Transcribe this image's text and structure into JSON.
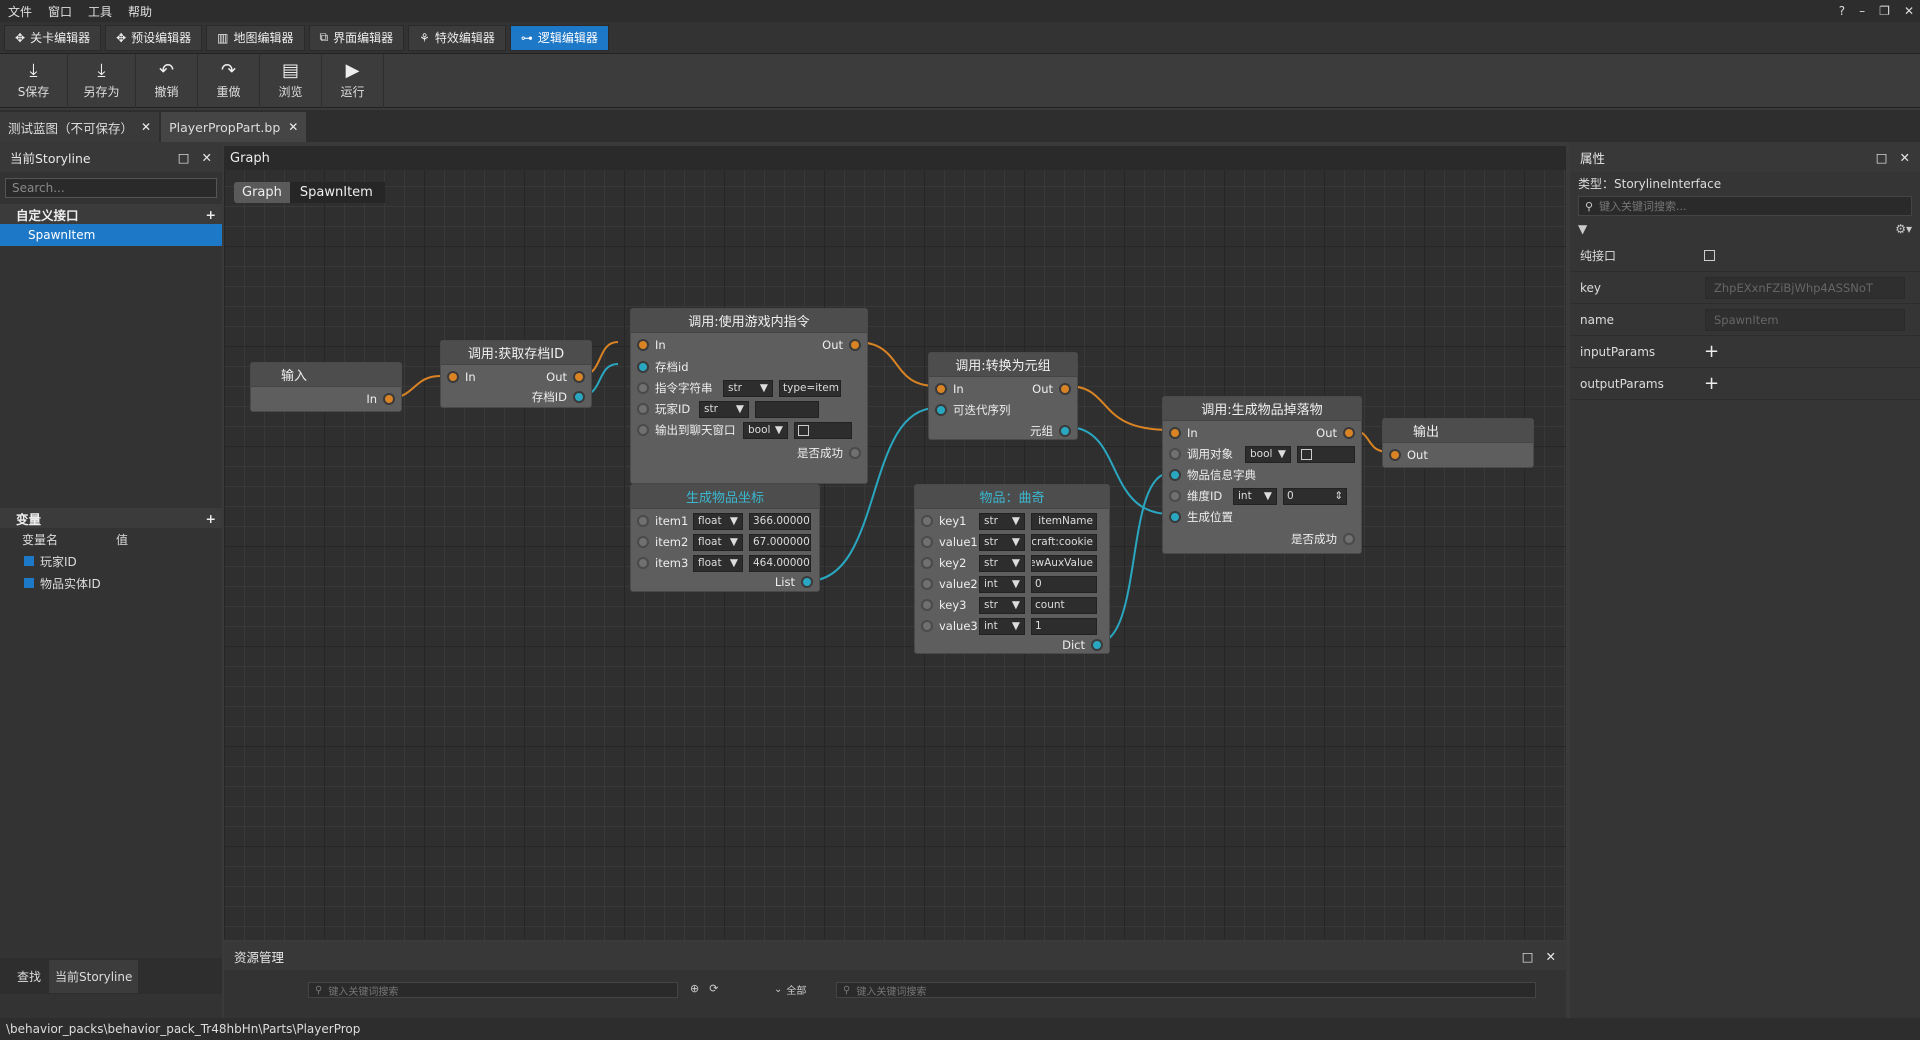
{
  "menu": [
    "文件",
    "窗口",
    "工具",
    "帮助"
  ],
  "window_controls": [
    "?",
    "–",
    "❐",
    "✕"
  ],
  "editor_tabs": [
    {
      "label": "关卡编辑器",
      "icon": "gear-cross-icon"
    },
    {
      "label": "预设编辑器",
      "icon": "gear-cross-icon"
    },
    {
      "label": "地图编辑器",
      "icon": "map-icon"
    },
    {
      "label": "界面编辑器",
      "icon": "window-icon"
    },
    {
      "label": "特效编辑器",
      "icon": "effects-icon"
    },
    {
      "label": "逻辑编辑器",
      "icon": "logic-icon",
      "active": true
    }
  ],
  "toolbar": [
    {
      "label": "S保存",
      "icon": "⤓"
    },
    {
      "label": "另存为",
      "icon": "⤓"
    },
    {
      "label": "撤销",
      "icon": "↶"
    },
    {
      "label": "重做",
      "icon": "↷"
    },
    {
      "label": "浏览",
      "icon": "▤"
    },
    {
      "label": "运行",
      "icon": "▶"
    }
  ],
  "doc_tabs": [
    {
      "label": "测试蓝图（不可保存）"
    },
    {
      "label": "PlayerPropPart.bp",
      "active": true
    }
  ],
  "left": {
    "title": "当前Storyline",
    "search_placeholder": "Search...",
    "custom_interfaces_header": "自定义接口",
    "interfaces": [
      "SpawnItem"
    ],
    "variables_header": "变量",
    "var_col_name": "变量名",
    "var_col_value": "值",
    "variables": [
      "玩家ID",
      "物品实体ID"
    ],
    "bottom_tabs": [
      "查找",
      "当前Storyline"
    ]
  },
  "graph": {
    "header": "Graph",
    "crumb1": "Graph",
    "crumb2": "SpawnItem",
    "nodes": {
      "input": {
        "title": "输入",
        "out": "In"
      },
      "getsave": {
        "title": "调用:获取存档ID",
        "in": "In",
        "out": "Out",
        "out2": "存档ID"
      },
      "cmd": {
        "title": "调用:使用游戏内指令",
        "in": "In",
        "out": "Out",
        "p1": "存档id",
        "p2": "指令字符串",
        "p2type": "str",
        "p2val": "type=item]",
        "p3": "玩家ID",
        "p3type": "str",
        "p4": "输出到聊天窗口",
        "p4type": "bool",
        "ok": "是否成功"
      },
      "tuple": {
        "title": "调用:转换为元组",
        "in": "In",
        "out": "Out",
        "p1": "可迭代序列",
        "out2": "元组"
      },
      "spawn": {
        "title": "调用:生成物品掉落物",
        "in": "In",
        "out": "Out",
        "p1": "调用对象",
        "p1type": "bool",
        "p2": "物品信息字典",
        "p3": "维度ID",
        "p3type": "int",
        "p3val": "0",
        "p4": "生成位置",
        "ok": "是否成功"
      },
      "output": {
        "title": "输出",
        "in": "Out"
      },
      "coords": {
        "title": "生成物品坐标",
        "items": [
          {
            "name": "item1",
            "type": "float",
            "val": "366.00000"
          },
          {
            "name": "item2",
            "type": "float",
            "val": "67.000000"
          },
          {
            "name": "item3",
            "type": "float",
            "val": "464.00000"
          }
        ],
        "out": "List"
      },
      "dict": {
        "title": "物品：曲奇",
        "rows": [
          {
            "name": "key1",
            "type": "str",
            "val": "itemName"
          },
          {
            "name": "value1",
            "type": "str",
            "val": "craft:cookie"
          },
          {
            "name": "key2",
            "type": "str",
            "val": "newAuxValue"
          },
          {
            "name": "value2",
            "type": "int",
            "val": "0"
          },
          {
            "name": "key3",
            "type": "str",
            "val": "count"
          },
          {
            "name": "value3",
            "type": "int",
            "val": "1"
          }
        ],
        "out": "Dict"
      }
    }
  },
  "right": {
    "title": "属性",
    "type_line": "类型：StorylineInterface",
    "search_placeholder": "键入关键词搜索...",
    "props": [
      {
        "label": "纯接口"
      },
      {
        "label": "key",
        "value": "ZhpEXxnFZiBjWhp4ASSNoT"
      },
      {
        "label": "name",
        "value": "SpawnItem"
      },
      {
        "label": "inputParams"
      },
      {
        "label": "outputParams"
      }
    ]
  },
  "assets": {
    "title": "资源管理",
    "search_placeholder": "键入关键词搜索",
    "all_label": "全部"
  },
  "status": "\\behavior_packs\\behavior_pack_Tr48hbHn\\Parts\\PlayerProp"
}
